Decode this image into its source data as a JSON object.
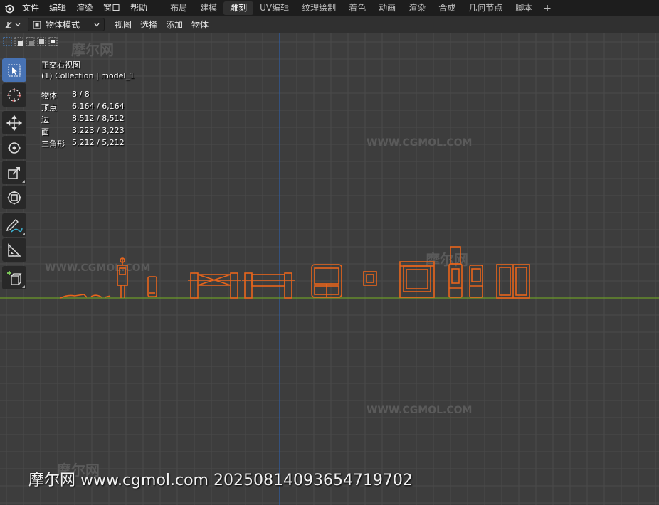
{
  "menubar": {
    "items": [
      "文件",
      "编辑",
      "渲染",
      "窗口",
      "帮助"
    ],
    "workspaces": [
      "布局",
      "建模",
      "雕刻",
      "UV编辑",
      "纹理绘制",
      "着色",
      "动画",
      "渲染",
      "合成",
      "几何节点",
      "脚本"
    ],
    "active_workspace": "雕刻",
    "add_tab_label": "+"
  },
  "header": {
    "mode": "物体模式",
    "menus": [
      "视图",
      "选择",
      "添加",
      "物体"
    ]
  },
  "overlay": {
    "view_name": "正交右视图",
    "collection": "(1) Collection | model_1",
    "stats": [
      {
        "label": "物体",
        "value": "8 / 8"
      },
      {
        "label": "顶点",
        "value": "6,164 / 6,164"
      },
      {
        "label": "边",
        "value": "8,512 / 8,512"
      },
      {
        "label": "面",
        "value": "3,223 / 3,223"
      },
      {
        "label": "三角形",
        "value": "5,212 / 5,212"
      }
    ]
  },
  "toolbar": {
    "tools": [
      "select-box-icon",
      "cursor-icon",
      "move-icon",
      "rotate-icon",
      "scale-icon",
      "transform-icon",
      "annotate-icon",
      "measure-icon",
      "add-cube-icon"
    ],
    "active_tool": "select-box-icon"
  },
  "watermarks": {
    "site_text": "WWW.CGMOL.COM",
    "logo_text": "摩尔网"
  },
  "footer_watermark": "摩尔网 www.cgmol.com 20250814093654719702",
  "colors": {
    "background": "#3d3d3d",
    "grid_line": "#4a4a4a",
    "y_axis": "#2f5fa8",
    "z_axis": "#6b9a2a",
    "selection": "#e8651c",
    "active_tab": "#303030",
    "active_tool": "#4772b3"
  }
}
